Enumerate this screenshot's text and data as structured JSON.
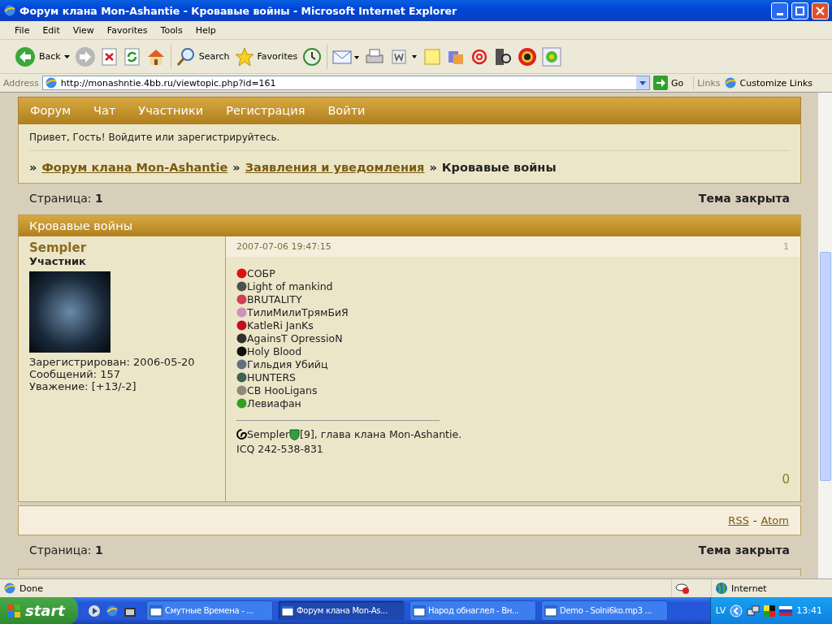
{
  "window": {
    "title": "Форум клана Mon-Ashantie - Кровавые войны - Microsoft Internet Explorer"
  },
  "menu": [
    "File",
    "Edit",
    "View",
    "Favorites",
    "Tools",
    "Help"
  ],
  "toolbar": {
    "back": "Back",
    "search": "Search",
    "favorites": "Favorites"
  },
  "address": {
    "label": "Address",
    "value": "http://monashntie.4bb.ru/viewtopic.php?id=161",
    "go": "Go",
    "links_label": "Links",
    "links": [
      "Customize Links"
    ]
  },
  "forum": {
    "nav": [
      "Форум",
      "Чат",
      "Участники",
      "Регистрация",
      "Войти"
    ],
    "greeting": "Привет, Гость!  Войдите или зарегистрируйтесь.",
    "separator": "»",
    "breadcrumbs": [
      {
        "text": "Форум клана Mon-Ashantie",
        "link": true
      },
      {
        "text": "Заявления и уведомления",
        "link": true
      },
      {
        "text": "Кровавые войны",
        "link": false
      }
    ],
    "page_top": {
      "label": "Страница:",
      "number": "1",
      "status": "Тема закрыта"
    },
    "post": {
      "title": "Кровавые войны",
      "author": "Sempler",
      "rank": "Участник",
      "stats": [
        "Зарегистрирован: 2006-05-20",
        "Сообщений: 157",
        "Уважение: [+13/-2]"
      ],
      "date": "2007-07-06 19:47:15",
      "number": "1",
      "clans": [
        {
          "name": "СОБР",
          "color": "#e01010"
        },
        {
          "name": "Light of mankind",
          "color": "#505050"
        },
        {
          "name": "BRUTALITY",
          "color": "#d04050"
        },
        {
          "name": "ТилиМилиТрямБиЯ",
          "color": "#d090c0"
        },
        {
          "name": "KatleRi JanKs",
          "color": "#c01020"
        },
        {
          "name": "AgainsT OpressioN",
          "color": "#303030"
        },
        {
          "name": "Holy Blood",
          "color": "#101010"
        },
        {
          "name": "Гильдия Убийц",
          "color": "#607080"
        },
        {
          "name": "HUNTERS",
          "color": "#406050"
        },
        {
          "name": "CB HooLigans",
          "color": "#908878"
        },
        {
          "name": "Левиафан",
          "color": "#30a020"
        }
      ],
      "signature_name": "Sempler",
      "signature_rest": "[9], глава клана Mon-Ashantie.",
      "icq": "ICQ 242-538-831",
      "rating": "0"
    },
    "feeds": [
      "RSS",
      "Atom"
    ],
    "feed_separator": "-",
    "page_bottom": {
      "label": "Страница:",
      "number": "1",
      "status": "Тема закрыта"
    }
  },
  "status_bar": {
    "text": "Done",
    "zone": "Internet"
  },
  "taskbar": {
    "start": "start",
    "tasks": [
      {
        "label": "Смутные Времена - ...",
        "selected": false
      },
      {
        "label": "Форум клана Mon-As...",
        "selected": true
      },
      {
        "label": "Народ обнаглел - Вн...",
        "selected": false
      },
      {
        "label": "Demo - Solni6ko.mp3 ...",
        "selected": false
      }
    ],
    "language": "LV",
    "clock": "13:41"
  }
}
